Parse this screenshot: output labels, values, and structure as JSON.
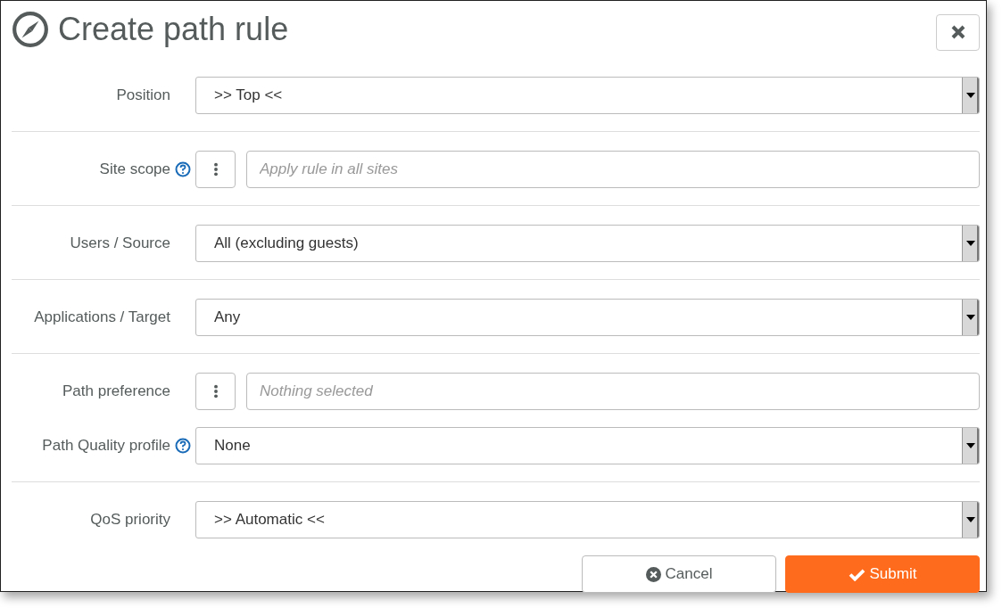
{
  "dialog": {
    "title": "Create path rule"
  },
  "sections": [
    {
      "fields": [
        {
          "label": "Position",
          "help": false,
          "kind": "select",
          "value": ">> Top <<"
        }
      ]
    },
    {
      "fields": [
        {
          "label": "Site scope",
          "help": true,
          "kind": "picker",
          "placeholder": "Apply rule in all sites"
        }
      ]
    },
    {
      "fields": [
        {
          "label": "Users / Source",
          "help": false,
          "kind": "select",
          "value": "All (excluding guests)"
        }
      ]
    },
    {
      "fields": [
        {
          "label": "Applications / Target",
          "help": false,
          "kind": "select",
          "value": "Any"
        }
      ]
    },
    {
      "fields": [
        {
          "label": "Path preference",
          "help": false,
          "kind": "picker",
          "placeholder": "Nothing selected"
        },
        {
          "label": "Path Quality profile",
          "help": true,
          "kind": "select",
          "value": "None"
        }
      ]
    },
    {
      "fields": [
        {
          "label": "QoS priority",
          "help": false,
          "kind": "select",
          "value": ">> Automatic <<"
        }
      ]
    }
  ],
  "buttons": [
    {
      "label": "Cancel",
      "kind": "cancel"
    },
    {
      "label": "Submit",
      "kind": "submit"
    }
  ]
}
